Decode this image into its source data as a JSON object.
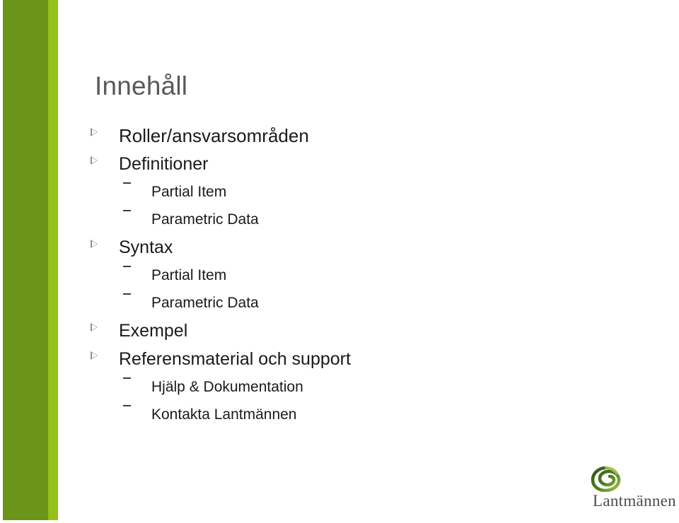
{
  "slide": {
    "title": "Innehåll",
    "background_color": "#ffffff",
    "accent_dark_green": "#6a9518",
    "accent_light_green": "#95c11a",
    "title_color": "#595959",
    "text_color": "#1a1a1a"
  },
  "outline": [
    {
      "level": 1,
      "marker": "triangle-outline-bullet",
      "text": "Roller/ansvarsområden"
    },
    {
      "level": 1,
      "marker": "triangle-outline-bullet",
      "text": "Definitioner"
    },
    {
      "level": 2,
      "marker": "dash-bullet",
      "text": "Partial Item"
    },
    {
      "level": 2,
      "marker": "dash-bullet",
      "text": "Parametric Data"
    },
    {
      "level": 1,
      "marker": "triangle-outline-bullet",
      "text": "Syntax"
    },
    {
      "level": 2,
      "marker": "dash-bullet",
      "text": "Partial Item"
    },
    {
      "level": 2,
      "marker": "dash-bullet",
      "text": "Parametric Data"
    },
    {
      "level": 1,
      "marker": "triangle-outline-bullet",
      "text": "Exempel"
    },
    {
      "level": 1,
      "marker": "triangle-outline-bullet",
      "text": "Referensmaterial och support"
    },
    {
      "level": 2,
      "marker": "dash-bullet",
      "text": "Hjälp & Dokumentation"
    },
    {
      "level": 2,
      "marker": "dash-bullet",
      "text": "Kontakta Lantmännen"
    }
  ],
  "logo": {
    "wordmark": "Lantmännen",
    "mark_name": "lantmannen-spiral-logo-icon",
    "mark_color_dark": "#3f6b1f",
    "mark_color_light": "#a6c64a"
  }
}
